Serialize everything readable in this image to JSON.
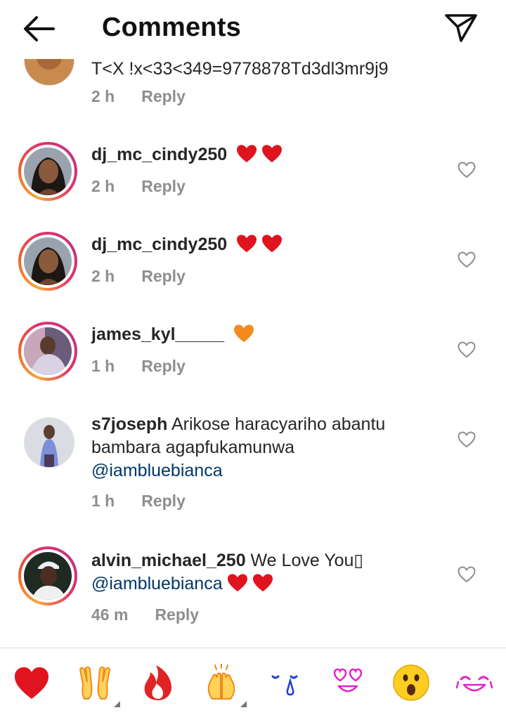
{
  "header": {
    "title": "Comments"
  },
  "comments": [
    {
      "username": "",
      "text": "T<X !x<33<349=9778878Td3dl3mr9j9",
      "time": "2 h",
      "reply": "Reply",
      "mention": ""
    },
    {
      "username": "dj_mc_cindy250",
      "text": "",
      "time": "2 h",
      "reply": "Reply",
      "mention": ""
    },
    {
      "username": "dj_mc_cindy250",
      "text": "",
      "time": "2 h",
      "reply": "Reply",
      "mention": ""
    },
    {
      "username": "james_kyl_____",
      "text": "",
      "time": "1 h",
      "reply": "Reply",
      "mention": ""
    },
    {
      "username": "s7joseph",
      "text": " Arikose haracyariho abantu bambara agapfukamunwa",
      "time": "1 h",
      "reply": "Reply",
      "mention": "@iambluebianca"
    },
    {
      "username": "alvin_michael_250",
      "text": " We Love You▯",
      "time": "46 m",
      "reply": "Reply",
      "mention": "@iambluebianca"
    }
  ],
  "icons": {
    "back": "arrow-left-icon",
    "send": "paper-plane-icon",
    "like": "heart-outline-icon",
    "red_heart": "#e0141e",
    "orange_heart": "#f58a1f"
  },
  "emoji_bar": [
    "red-heart",
    "raising-hands",
    "fire",
    "clapping-hands",
    "crying-face",
    "heart-eyes",
    "astonished-face",
    "tears-of-joy"
  ]
}
